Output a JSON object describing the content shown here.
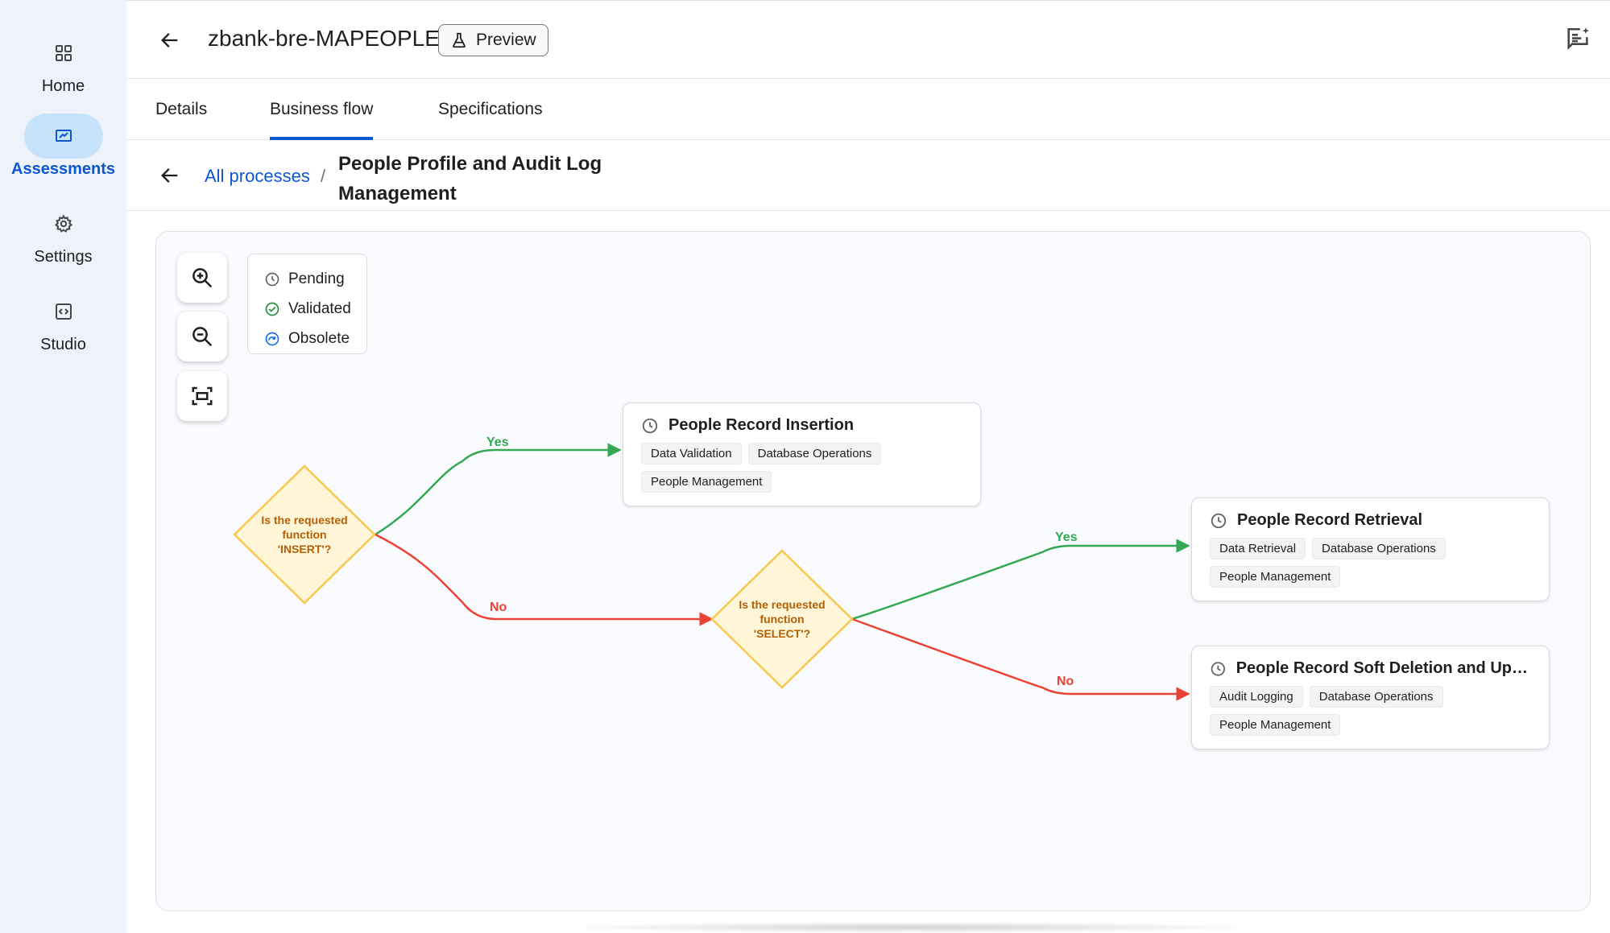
{
  "sidebar": {
    "items": [
      {
        "label": "Home",
        "icon": "grid-icon",
        "active": false
      },
      {
        "label": "Assessments",
        "icon": "assessment-icon",
        "active": true
      },
      {
        "label": "Settings",
        "icon": "gear-icon",
        "active": false
      },
      {
        "label": "Studio",
        "icon": "code-box-icon",
        "active": false
      }
    ]
  },
  "header": {
    "title": "zbank-bre-MAPEOPLE",
    "preview_label": "Preview"
  },
  "tabs": [
    {
      "label": "Details",
      "active": false
    },
    {
      "label": "Business flow",
      "active": true
    },
    {
      "label": "Specifications",
      "active": false
    }
  ],
  "breadcrumb": {
    "link": "All processes",
    "separator": "/",
    "current": "People Profile and Audit Log Management"
  },
  "legend": [
    {
      "label": "Pending",
      "icon": "clock-icon",
      "color": "#5f6368"
    },
    {
      "label": "Validated",
      "icon": "check-circle-icon",
      "color": "#1e8e3e"
    },
    {
      "label": "Obsolete",
      "icon": "obsolete-icon",
      "color": "#1a73e8"
    }
  ],
  "flow": {
    "decisions": [
      {
        "label": "Is the requested function 'INSERT'?"
      },
      {
        "label": "Is the requested function 'SELECT'?"
      }
    ],
    "edges": [
      {
        "label": "Yes",
        "color": "#34a853"
      },
      {
        "label": "No",
        "color": "#ea4335"
      },
      {
        "label": "Yes",
        "color": "#34a853"
      },
      {
        "label": "No",
        "color": "#ea4335"
      }
    ],
    "nodes": [
      {
        "title": "People Record Insertion",
        "status": "Pending",
        "tags": [
          "Data Validation",
          "Database Operations",
          "People Management"
        ]
      },
      {
        "title": "People Record Retrieval",
        "status": "Pending",
        "tags": [
          "Data Retrieval",
          "Database Operations",
          "People Management"
        ]
      },
      {
        "title": "People Record Soft Deletion and Updat...",
        "status": "Pending",
        "tags": [
          "Audit Logging",
          "Database Operations",
          "People Management"
        ]
      }
    ]
  },
  "colors": {
    "accent": "#0b57d0",
    "decision_fill": "#fff6d8",
    "decision_stroke": "#f9c74f",
    "yes": "#34a853",
    "no": "#ea4335"
  }
}
